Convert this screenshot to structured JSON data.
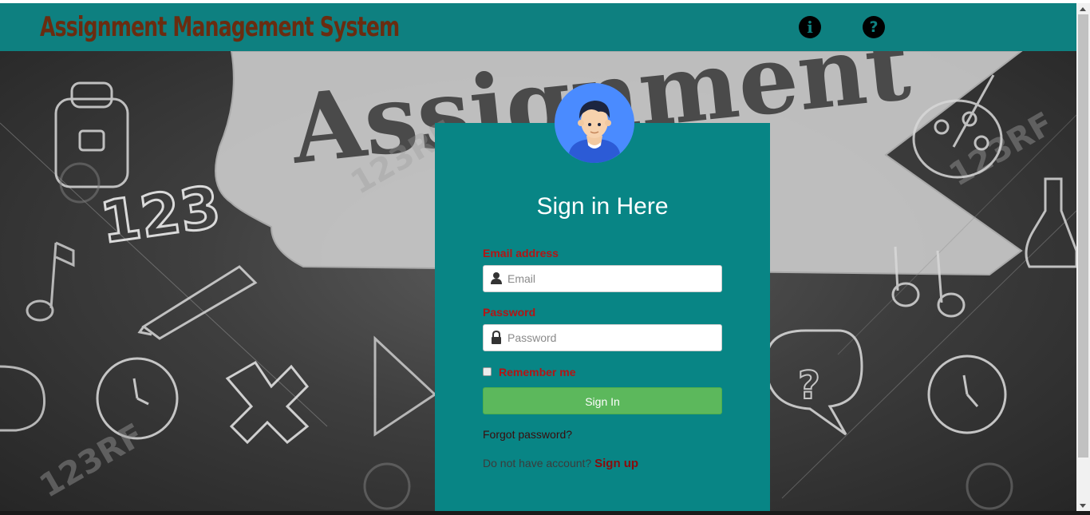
{
  "header": {
    "title": "Assignment Management System",
    "info_icon": "info-icon",
    "help_icon": "help-icon",
    "info_glyph": "i",
    "help_glyph": "?"
  },
  "background": {
    "banner_word": "Assignment",
    "numbers": "123",
    "watermark": "123RF"
  },
  "login": {
    "title": "Sign in Here",
    "email_label": "Email address",
    "email_placeholder": "Email",
    "email_value": "",
    "password_label": "Password",
    "password_placeholder": "Password",
    "password_value": "",
    "remember_label": "Remember me",
    "remember_checked": false,
    "signin_label": "Sign In",
    "forgot_label": "Forgot password?",
    "no_account_text": "Do not have account?",
    "signup_label": "Sign up"
  },
  "colors": {
    "header_bg": "#0e8080",
    "title_color": "#6a2c10",
    "card_bg": "#088585",
    "label_red": "#b41414",
    "button_green": "#5cb85c"
  }
}
